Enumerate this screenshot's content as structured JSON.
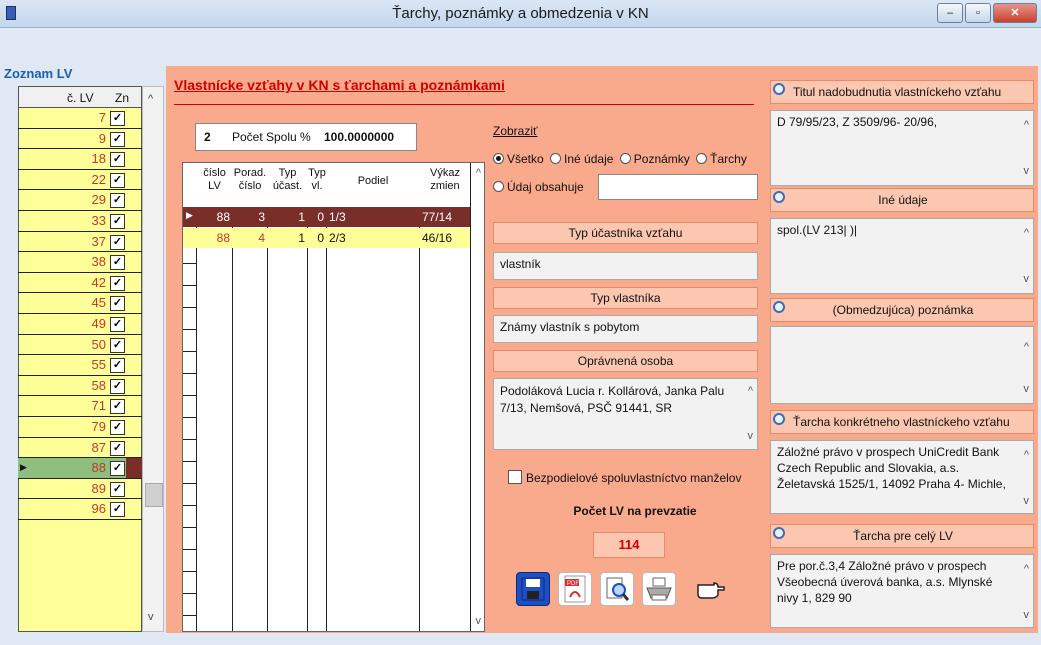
{
  "window": {
    "title": "Ťarchy, poznámky a obmedzenia  v KN",
    "min": "–",
    "max": "▫",
    "close": "✕"
  },
  "left": {
    "title": "Zoznam LV",
    "col_lv": "č. LV",
    "col_zn": "Zn",
    "rows": [
      "7",
      "9",
      "18",
      "22",
      "29",
      "33",
      "37",
      "38",
      "42",
      "45",
      "49",
      "50",
      "55",
      "58",
      "71",
      "79",
      "87",
      "88",
      "89",
      "96"
    ],
    "check": "✓",
    "selected_index": 17
  },
  "main": {
    "heading": "Vlastnícke vzťahy v KN s ťarchami a poznámkami",
    "count_value": "2",
    "count_label": "Počet",
    "spolu_label": "Spolu %",
    "spolu_value": "100.0000000",
    "columns": [
      "číslo LV",
      "Porad. číslo",
      "Typ účast.",
      "Typ vl.",
      "Podiel",
      "Výkaz zmien"
    ],
    "rows": [
      {
        "lv": "88",
        "porad": "3",
        "typ_ucast": "1",
        "typ_vl": "0",
        "podiel": "1/3",
        "vykaz": "77/14"
      },
      {
        "lv": "88",
        "porad": "4",
        "typ_ucast": "1",
        "typ_vl": "0",
        "podiel": "2/3",
        "vykaz": "46/16"
      }
    ]
  },
  "filter": {
    "label": "Zobraziť",
    "options": [
      "Všetko",
      "Iné údaje",
      "Poznámky",
      "Ťarchy"
    ],
    "selected": "Všetko",
    "udaj_label": "Údaj obsahuje",
    "udaj_value": ""
  },
  "details": {
    "typ_ucastnika_label": "Typ účastníka vzťahu",
    "typ_ucastnika_value": "vlastník",
    "typ_vlastnika_label": "Typ vlastníka",
    "typ_vlastnika_value": "Známy vlastník s pobytom",
    "opravnena_label": "Oprávnená osoba",
    "opravnena_value": "Podoláková Lucia r. Kollárová, Janka Palu 7/13, Nemšová, PSČ 91441, SR",
    "bezpodiel_label": "Bezpodielové spoluvlastníctvo manželov",
    "pocet_lv_label": "Počet LV na prevzatie",
    "pocet_lv_value": "114"
  },
  "right": {
    "titul_label": "Titul nadobudnutia vlastníckeho vzťahu",
    "titul_value": "D 79/95/23, Z 3509/96- 20/96,",
    "ine_label": "Iné údaje",
    "ine_value": "spol.(LV 213| )|",
    "obmedz_label": "(Obmedzujúca) poznámka",
    "obmedz_value": "",
    "tarcha_konkr_label": "Ťarcha konkrétneho vlastníckeho vzťahu",
    "tarcha_konkr_value": "Záložné právo v prospech UniCredit Bank Czech Republic and Slovakia, a.s. Želetavská 1525/1, 14092 Praha 4- Michle,",
    "tarcha_lv_label": "Ťarcha pre celý LV",
    "tarcha_lv_value": "Pre por.č.3,4 Záložné právo v prospech Všeobecná úverová banka, a.s. Mlynské nivy 1, 829 90"
  },
  "toolbar": {
    "pdf_text": "PDF"
  },
  "icons": [
    "save-icon",
    "pdf-icon",
    "preview-icon",
    "print-icon",
    "pointer-hand-icon",
    "magnifier-icon"
  ]
}
